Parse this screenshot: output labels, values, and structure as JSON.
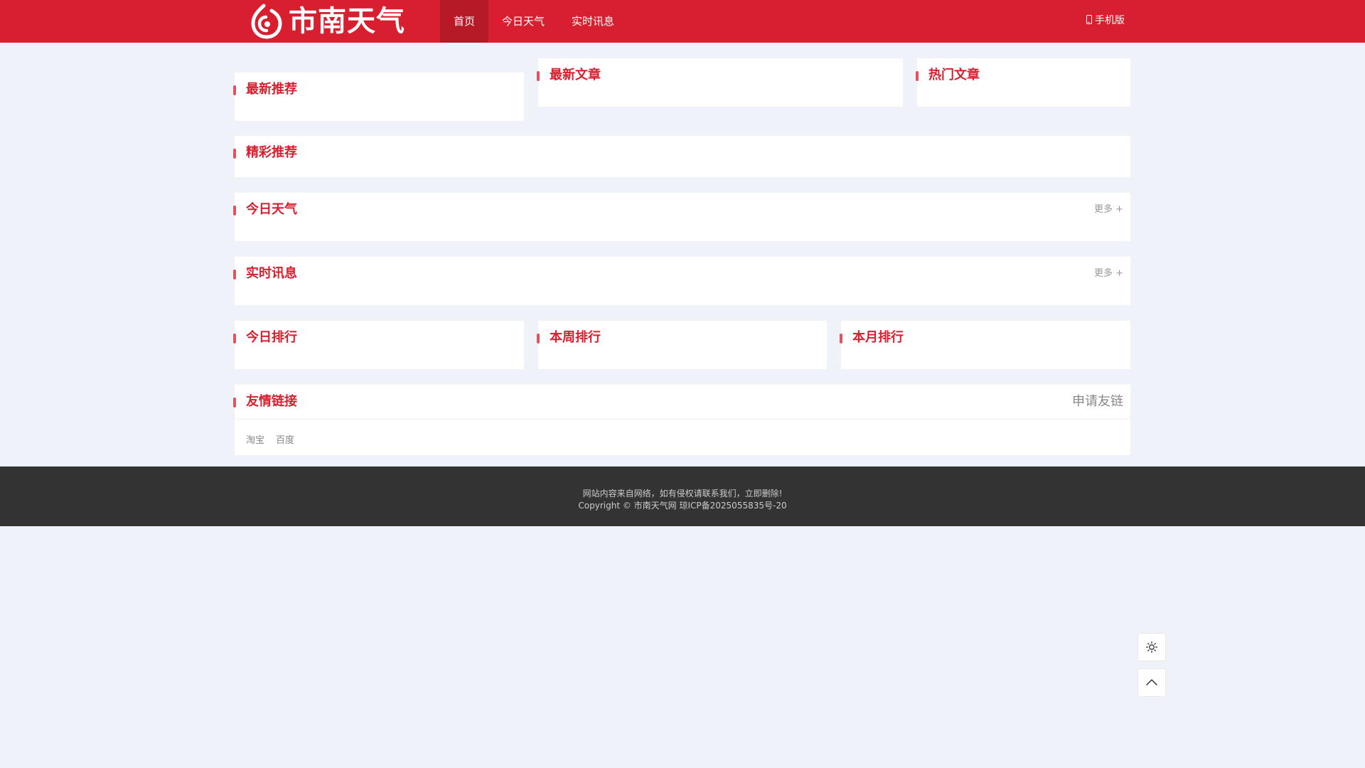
{
  "site": {
    "logo_text": "市南天气"
  },
  "nav": {
    "items": [
      {
        "label": "首页"
      },
      {
        "label": "今日天气"
      },
      {
        "label": "实时讯息"
      }
    ],
    "mobile_label": "手机版"
  },
  "sections": {
    "latest_recommend": "最新推荐",
    "latest_articles": "最新文章",
    "hot_articles": "热门文章",
    "featured": "精彩推荐",
    "today_weather": "今日天气",
    "realtime_news": "实时讯息",
    "today_rank": "今日排行",
    "week_rank": "本周排行",
    "month_rank": "本月排行",
    "friend_links": "友情链接"
  },
  "more_label": "更多 +",
  "apply_link_label": "申请友链",
  "friend_links": [
    "淘宝",
    "百度"
  ],
  "footer": {
    "line1": "网站内容来自网络，如有侵权请联系我们，立即删除!",
    "line2": "Copyright © 市南天气网 琼ICP备2025055835号-20"
  },
  "colors": {
    "brand": "#d81f2f",
    "nav_active": "#b61a27",
    "page_bg": "#eff3f9",
    "footer_bg": "#333333"
  },
  "icons": {
    "logo": "drop-swirl-icon",
    "mobile": "phone-icon",
    "theme": "sun-icon",
    "back_to_top": "chevron-up-icon"
  }
}
